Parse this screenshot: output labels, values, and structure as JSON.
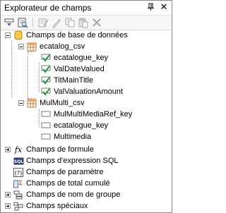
{
  "panel": {
    "title": "Explorateur de champs"
  },
  "toolbar": {
    "buttons": [
      "insert-field-icon",
      "browse-icon",
      "edit-icon",
      "rename-icon",
      "copy-icon",
      "paste-icon",
      "delete-icon"
    ]
  },
  "tree": {
    "database": {
      "label": "Champs de base de données",
      "tables": [
        {
          "label": "ecatalog_csv",
          "fields": [
            "ecatalogue_key",
            "ValDateValued",
            "TitMainTitle",
            "ValValuationAmount"
          ]
        },
        {
          "label": "MulMulti_csv",
          "fields": [
            "MulMultiMediaRef_key",
            "ecatalogue_key",
            "Multimedia"
          ]
        }
      ]
    },
    "others": [
      {
        "label": "Champs de formule",
        "icon": "formula-icon"
      },
      {
        "label": "Champs d'expression SQL",
        "icon": "sql-icon"
      },
      {
        "label": "Champs de paramètre",
        "icon": "parameter-icon"
      },
      {
        "label": "Champs de total cumulé",
        "icon": "running-total-icon"
      },
      {
        "label": "Champs de nom de groupe",
        "icon": "group-name-icon"
      },
      {
        "label": "Champs spéciaux",
        "icon": "special-fields-icon"
      }
    ]
  }
}
